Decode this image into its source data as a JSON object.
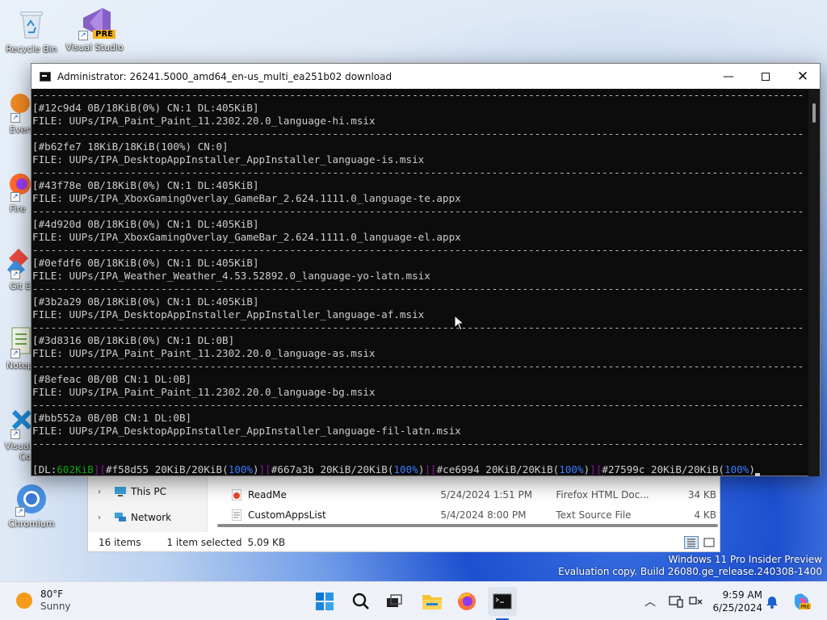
{
  "desktop": {
    "icons": [
      {
        "label": "Recycle Bin",
        "icon": "recycle-bin-icon"
      },
      {
        "label": "Visual Studio",
        "icon": "visual-studio-icon",
        "badge": "PRE"
      },
      {
        "label": "Every",
        "icon": "everything-icon"
      },
      {
        "label": "Fire",
        "icon": "firefox-icon"
      },
      {
        "label": "Git E",
        "icon": "git-extensions-icon"
      },
      {
        "label": "Notep",
        "icon": "notepad-icon"
      },
      {
        "label": "Visual",
        "icon": "vscode-icon",
        "label2": "Co"
      },
      {
        "label": "Chromium",
        "icon": "chromium-icon"
      }
    ]
  },
  "terminal": {
    "title": "Administrator:  26241.5000_amd64_en-us_multi_ea251b02 download",
    "separator": "--------------------------------------------------------------------------------------------------------------------------------------",
    "entries": [
      {
        "status": "[#12c9d4 0B/18KiB(0%) CN:1 DL:405KiB]",
        "file": "FILE: UUPs/IPA_Paint_Paint_11.2302.20.0_language-hi.msix"
      },
      {
        "status": "[#b62fe7 18KiB/18KiB(100%) CN:0]",
        "file": "FILE: UUPs/IPA_DesktopAppInstaller_AppInstaller_language-is.msix"
      },
      {
        "status": "[#43f78e 0B/18KiB(0%) CN:1 DL:405KiB]",
        "file": "FILE: UUPs/IPA_XboxGamingOverlay_GameBar_2.624.1111.0_language-te.appx"
      },
      {
        "status": "[#4d920d 0B/18KiB(0%) CN:1 DL:405KiB]",
        "file": "FILE: UUPs/IPA_XboxGamingOverlay_GameBar_2.624.1111.0_language-el.appx"
      },
      {
        "status": "[#0efdf6 0B/18KiB(0%) CN:1 DL:405KiB]",
        "file": "FILE: UUPs/IPA_Weather_Weather_4.53.52892.0_language-yo-latn.msix"
      },
      {
        "status": "[#3b2a29 0B/18KiB(0%) CN:1 DL:405KiB]",
        "file": "FILE: UUPs/IPA_DesktopAppInstaller_AppInstaller_language-af.msix"
      },
      {
        "status": "[#3d8316 0B/18KiB(0%) CN:1 DL:0B]",
        "file": "FILE: UUPs/IPA_Paint_Paint_11.2302.20.0_language-as.msix"
      },
      {
        "status": "[#8efeac 0B/0B CN:1 DL:0B]",
        "file": "FILE: UUPs/IPA_Paint_Paint_11.2302.20.0_language-bg.msix"
      },
      {
        "status": "[#bb552a 0B/0B CN:1 DL:0B]",
        "file": "FILE: UUPs/IPA_DesktopAppInstaller_AppInstaller_language-fil-latn.msix"
      }
    ],
    "summary": {
      "dl_label": "DL:",
      "dl_value": "602KiB",
      "items": [
        {
          "id": "#f58d55",
          "size": "20KiB/20KiB(",
          "pct": "100%",
          "end": ")"
        },
        {
          "id": "#667a3b",
          "size": "20KiB/20KiB(",
          "pct": "100%",
          "end": ")"
        },
        {
          "id": "#ce6994",
          "size": "20KiB/20KiB(",
          "pct": "100%",
          "end": ")"
        },
        {
          "id": "#27599c",
          "size": "20KiB/20KiB(",
          "pct": "100%",
          "end": ")"
        }
      ]
    },
    "colors": {
      "background": "#0c0c0c",
      "text": "#cccccc",
      "green": "#13a10e",
      "blue": "#3b78ff",
      "purple": "#881798"
    }
  },
  "explorer": {
    "nav": [
      {
        "label": "This PC",
        "icon": "this-pc-icon"
      },
      {
        "label": "Network",
        "icon": "network-icon"
      }
    ],
    "files": [
      {
        "name": "ReadMe",
        "date": "5/24/2024 1:51 PM",
        "type": "Firefox HTML Doc...",
        "size": "34 KB",
        "icon": "html-file-icon"
      },
      {
        "name": "CustomAppsList",
        "date": "5/4/2024 8:00 PM",
        "type": "Text Source File",
        "size": "4 KB",
        "icon": "text-file-icon"
      }
    ],
    "status": {
      "items": "16 items",
      "selected": "1 item selected",
      "size": "5.09 KB"
    }
  },
  "watermark": {
    "line1": "Windows 11 Pro Insider Preview",
    "line2": "Evaluation copy. Build 26080.ge_release.240308-1400"
  },
  "taskbar": {
    "weather": {
      "temp": "80°F",
      "condition": "Sunny"
    },
    "apps": [
      "start-icon",
      "search-icon",
      "task-view-icon",
      "file-explorer-icon",
      "firefox-icon",
      "terminal-icon"
    ],
    "clock": {
      "time": "9:59 AM",
      "date": "6/25/2024"
    }
  }
}
